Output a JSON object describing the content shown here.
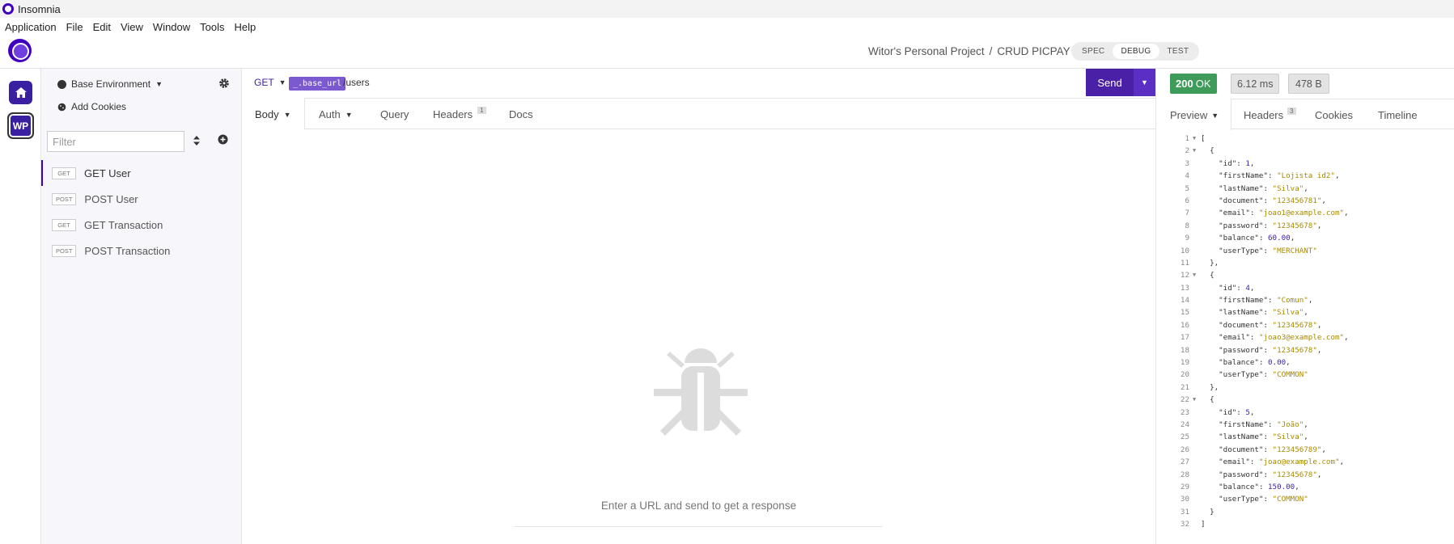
{
  "window": {
    "title": "Insomnia"
  },
  "menu": [
    "Application",
    "File",
    "Edit",
    "View",
    "Window",
    "Tools",
    "Help"
  ],
  "header": {
    "project": "Witor's Personal Project",
    "separator": "/",
    "collection": "CRUD PICPAY",
    "modes": [
      "SPEC",
      "DEBUG",
      "TEST"
    ],
    "active_mode": "DEBUG"
  },
  "rail": {
    "workspace_initials": "WP"
  },
  "sidebar": {
    "environment": "Base Environment",
    "add_cookies": "Add Cookies",
    "filter_placeholder": "Filter",
    "requests": [
      {
        "method": "GET",
        "name": "GET User",
        "active": true
      },
      {
        "method": "POST",
        "name": "POST User",
        "active": false
      },
      {
        "method": "GET",
        "name": "GET Transaction",
        "active": false
      },
      {
        "method": "POST",
        "name": "POST Transaction",
        "active": false
      }
    ]
  },
  "request": {
    "method": "GET",
    "url_variable": "_.base_url",
    "url_path": "/users",
    "send_label": "Send",
    "tabs": {
      "body": "Body",
      "auth": "Auth",
      "query": "Query",
      "headers": "Headers",
      "headers_count": "1",
      "docs": "Docs"
    },
    "empty_message": "Enter a URL and send to get a response"
  },
  "response": {
    "status_code": "200",
    "status_text": "OK",
    "time": "6.12 ms",
    "size": "478 B",
    "tabs": {
      "preview": "Preview",
      "headers": "Headers",
      "headers_count": "3",
      "cookies": "Cookies",
      "timeline": "Timeline"
    },
    "lines": [
      {
        "n": "1",
        "fold": true,
        "text": "["
      },
      {
        "n": "2",
        "fold": true,
        "text": "  {"
      },
      {
        "n": "3",
        "key": "id",
        "value": "1",
        "type": "num",
        "comma": true
      },
      {
        "n": "4",
        "key": "firstName",
        "value": "\"Lojista id2\"",
        "type": "str",
        "comma": true
      },
      {
        "n": "5",
        "key": "lastName",
        "value": "\"Silva\"",
        "type": "str",
        "comma": true
      },
      {
        "n": "6",
        "key": "document",
        "value": "\"123456781\"",
        "type": "str",
        "comma": true
      },
      {
        "n": "7",
        "key": "email",
        "value": "\"joao1@example.com\"",
        "type": "str",
        "comma": true
      },
      {
        "n": "8",
        "key": "password",
        "value": "\"12345678\"",
        "type": "str",
        "comma": true
      },
      {
        "n": "9",
        "key": "balance",
        "value": "60.00",
        "type": "num",
        "comma": true
      },
      {
        "n": "10",
        "key": "userType",
        "value": "\"MERCHANT\"",
        "type": "str",
        "comma": false
      },
      {
        "n": "11",
        "text": "  },"
      },
      {
        "n": "12",
        "fold": true,
        "text": "  {"
      },
      {
        "n": "13",
        "key": "id",
        "value": "4",
        "type": "num",
        "comma": true
      },
      {
        "n": "14",
        "key": "firstName",
        "value": "\"Comun\"",
        "type": "str",
        "comma": true
      },
      {
        "n": "15",
        "key": "lastName",
        "value": "\"Silva\"",
        "type": "str",
        "comma": true
      },
      {
        "n": "16",
        "key": "document",
        "value": "\"12345678\"",
        "type": "str",
        "comma": true
      },
      {
        "n": "17",
        "key": "email",
        "value": "\"joao3@example.com\"",
        "type": "str",
        "comma": true
      },
      {
        "n": "18",
        "key": "password",
        "value": "\"12345678\"",
        "type": "str",
        "comma": true
      },
      {
        "n": "19",
        "key": "balance",
        "value": "0.00",
        "type": "num",
        "comma": true
      },
      {
        "n": "20",
        "key": "userType",
        "value": "\"COMMON\"",
        "type": "str",
        "comma": false
      },
      {
        "n": "21",
        "text": "  },"
      },
      {
        "n": "22",
        "fold": true,
        "text": "  {"
      },
      {
        "n": "23",
        "key": "id",
        "value": "5",
        "type": "num",
        "comma": true
      },
      {
        "n": "24",
        "key": "firstName",
        "value": "\"João\"",
        "type": "str",
        "comma": true
      },
      {
        "n": "25",
        "key": "lastName",
        "value": "\"Silva\"",
        "type": "str",
        "comma": true
      },
      {
        "n": "26",
        "key": "document",
        "value": "\"123456789\"",
        "type": "str",
        "comma": true
      },
      {
        "n": "27",
        "key": "email",
        "value": "\"joao@example.com\"",
        "type": "str",
        "comma": true
      },
      {
        "n": "28",
        "key": "password",
        "value": "\"12345678\"",
        "type": "str",
        "comma": true
      },
      {
        "n": "29",
        "key": "balance",
        "value": "150.00",
        "type": "num",
        "comma": true
      },
      {
        "n": "30",
        "key": "userType",
        "value": "\"COMMON\"",
        "type": "str",
        "comma": false
      },
      {
        "n": "31",
        "text": "  }"
      },
      {
        "n": "32",
        "text": "]"
      }
    ]
  },
  "colors": {
    "brand": "#4000bf",
    "send": "#4a20a6",
    "status_ok": "#3e9b5a",
    "json_string": "#a68a00",
    "json_number": "#3b1fa3"
  },
  "icons": [
    "app-logo-icon",
    "home-icon",
    "gear-icon",
    "cookie-icon",
    "sort-icon",
    "add-circle-icon",
    "bug-icon",
    "chevron-down-icon"
  ]
}
